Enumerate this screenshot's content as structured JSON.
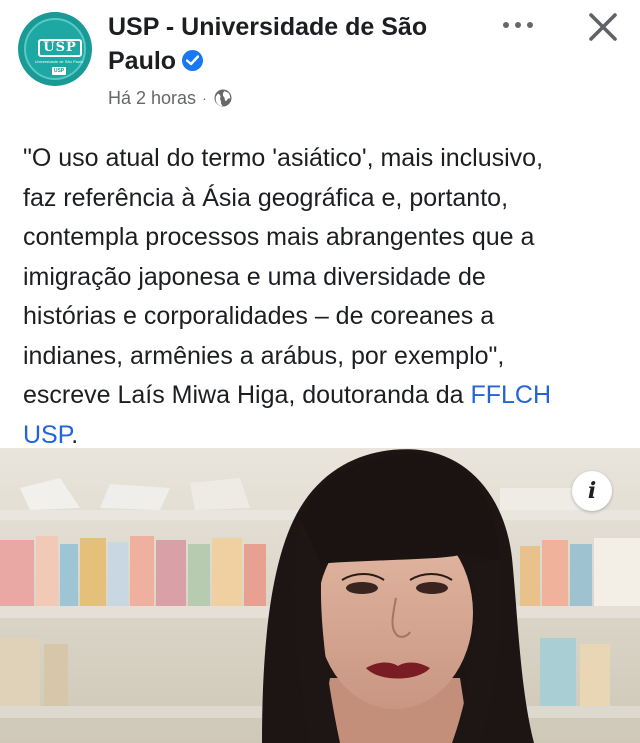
{
  "post": {
    "page_name": "USP - Universidade de São Paulo",
    "verified": true,
    "timestamp": "Há 2 horas",
    "meta_separator": "·",
    "audience_icon": "globe-icon",
    "text_line_1": "\"O uso atual do termo 'asiático', mais inclusivo,",
    "text_line_2": "faz referência à Ásia geográfica e, portanto,",
    "text_line_3": "contempla processos mais abrangentes que a",
    "text_line_4": "imigração japonesa e uma diversidade de",
    "text_line_5": "histórias e corporalidades – de coreanes a",
    "text_line_6": "indianes, armênies a arábus, por exemplo\",",
    "text_line_7_prefix": "escreve Laís Miwa Higa, doutoranda da ",
    "link_part_1": "FFLCH",
    "link_part_2": "USP",
    "text_end": "."
  },
  "avatar": {
    "logo_text": "USP",
    "sub_text": "Universidade de São Paulo",
    "badge_text": "USP"
  },
  "actions": {
    "more_icon": "more-horizontal-icon",
    "close_icon": "close-icon",
    "info_label": "i"
  },
  "colors": {
    "link": "#2364d9",
    "verified": "#1877f2",
    "avatar_bg": "#1a9a97",
    "text": "#1c1e21",
    "meta": "#65676b"
  }
}
